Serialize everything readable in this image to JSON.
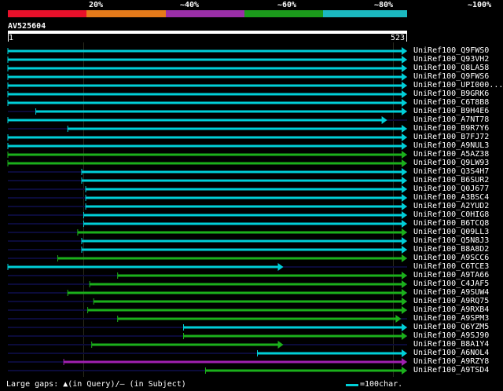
{
  "identity_scale": {
    "labels": [
      "20%",
      "~40%",
      "~60%",
      "~80%",
      "~100%"
    ],
    "colors": [
      "#e8102a",
      "#e57a1a",
      "#9b2fa8",
      "#1b9a1b",
      "#1bb8c0"
    ]
  },
  "query": {
    "name": "AV525604",
    "start": "1",
    "end": "523"
  },
  "hits": [
    {
      "name": "UniRef100_Q9FWS0",
      "color": "#00cfd8",
      "start": 0.0,
      "end": 1.0
    },
    {
      "name": "UniRef100_Q93VH2",
      "color": "#00cfd8",
      "start": 0.0,
      "end": 1.0
    },
    {
      "name": "UniRef100_Q8LA58",
      "color": "#00cfd8",
      "start": 0.0,
      "end": 1.0
    },
    {
      "name": "UniRef100_Q9FWS6",
      "color": "#00cfd8",
      "start": 0.0,
      "end": 1.0
    },
    {
      "name": "UniRef100_UPI000...",
      "color": "#00cfd8",
      "start": 0.0,
      "end": 1.0
    },
    {
      "name": "UniRef100_B9GRK6",
      "color": "#00cfd8",
      "start": 0.0,
      "end": 1.0
    },
    {
      "name": "UniRef100_C6T8B8",
      "color": "#00cfd8",
      "start": 0.0,
      "end": 1.0
    },
    {
      "name": "UniRef100_B9H4E6",
      "color": "#00cfd8",
      "start": 0.07,
      "end": 1.0
    },
    {
      "name": "UniRef100_A7NT78",
      "color": "#00cfd8",
      "start": 0.0,
      "end": 0.95
    },
    {
      "name": "UniRef100_B9R7Y6",
      "color": "#00cfd8",
      "start": 0.15,
      "end": 1.0
    },
    {
      "name": "UniRef100_B7FJ72",
      "color": "#00cfd8",
      "start": 0.0,
      "end": 1.0
    },
    {
      "name": "UniRef100_A9NUL3",
      "color": "#00cfd8",
      "start": 0.0,
      "end": 1.0
    },
    {
      "name": "UniRef100_A5AZ38",
      "color": "#1bb01b",
      "start": 0.0,
      "end": 1.0
    },
    {
      "name": "UniRef100_Q9LW93",
      "color": "#1bb01b",
      "start": 0.0,
      "end": 1.0
    },
    {
      "name": "UniRef100_Q3S4H7",
      "color": "#00cfd8",
      "start": 0.185,
      "end": 1.0
    },
    {
      "name": "UniRef100_B6SUR2",
      "color": "#00cfd8",
      "start": 0.185,
      "end": 1.0
    },
    {
      "name": "UniRef100_Q0J677",
      "color": "#00cfd8",
      "start": 0.195,
      "end": 1.0
    },
    {
      "name": "UniRef100_A3BSC4",
      "color": "#00cfd8",
      "start": 0.195,
      "end": 1.0
    },
    {
      "name": "UniRef100_A2YUD2",
      "color": "#00cfd8",
      "start": 0.195,
      "end": 1.0
    },
    {
      "name": "UniRef100_C0HIG8",
      "color": "#00cfd8",
      "start": 0.19,
      "end": 1.0
    },
    {
      "name": "UniRef100_B6TCQ8",
      "color": "#00cfd8",
      "start": 0.19,
      "end": 1.0
    },
    {
      "name": "UniRef100_Q09LL3",
      "color": "#1bb01b",
      "start": 0.175,
      "end": 1.0
    },
    {
      "name": "UniRef100_Q5N8J3",
      "color": "#00cfd8",
      "start": 0.185,
      "end": 1.0
    },
    {
      "name": "UniRef100_B8A8D2",
      "color": "#00cfd8",
      "start": 0.185,
      "end": 1.0
    },
    {
      "name": "UniRef100_A9SCC6",
      "color": "#1bb01b",
      "start": 0.125,
      "end": 1.0
    },
    {
      "name": "UniRef100_C6TCE3",
      "color": "#00cfd8",
      "start": 0.0,
      "end": 0.69
    },
    {
      "name": "UniRef100_A9TA66",
      "color": "#1bb01b",
      "start": 0.275,
      "end": 1.0
    },
    {
      "name": "UniRef100_C4JAF5",
      "color": "#1bb01b",
      "start": 0.205,
      "end": 1.0
    },
    {
      "name": "UniRef100_A9SUW4",
      "color": "#1bb01b",
      "start": 0.15,
      "end": 1.0
    },
    {
      "name": "UniRef100_A9RQ75",
      "color": "#1bb01b",
      "start": 0.215,
      "end": 1.0
    },
    {
      "name": "UniRef100_A9RXB4",
      "color": "#1bb01b",
      "start": 0.2,
      "end": 1.0
    },
    {
      "name": "UniRef100_A9SPM3",
      "color": "#1bb01b",
      "start": 0.275,
      "end": 0.985
    },
    {
      "name": "UniRef100_Q6YZM5",
      "color": "#00cfd8",
      "start": 0.44,
      "end": 1.0
    },
    {
      "name": "UniRef100_A9SJ90",
      "color": "#1bb01b",
      "start": 0.44,
      "end": 1.0
    },
    {
      "name": "UniRef100_B8A1Y4",
      "color": "#1bb01b",
      "start": 0.21,
      "end": 0.69
    },
    {
      "name": "UniRef100_A6NOL4",
      "color": "#00cfd8",
      "start": 0.625,
      "end": 1.0
    },
    {
      "name": "UniRef100_A9RZY8",
      "color": "#a020b0",
      "start": 0.14,
      "end": 1.0
    },
    {
      "name": "UniRef100_A9TSD4",
      "color": "#1bb01b",
      "start": 0.495,
      "end": 1.0
    }
  ],
  "legend": {
    "gaps_text": "Large gaps: ▲(in Query)/– (in Subject)",
    "scale_color": "#00cfd8",
    "scale_text": "=100char."
  }
}
